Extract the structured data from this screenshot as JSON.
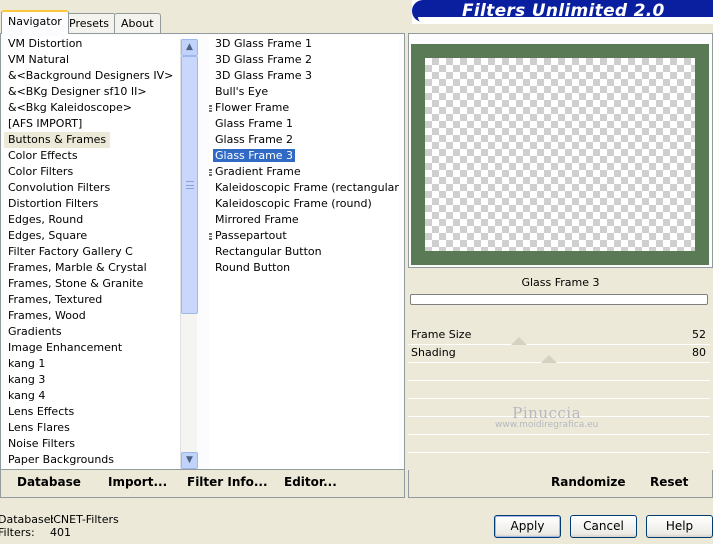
{
  "tabs": [
    {
      "label": "Navigator",
      "active": true
    },
    {
      "label": "Presets",
      "active": false
    },
    {
      "label": "About",
      "active": false
    }
  ],
  "banner_title": "Filters Unlimited 2.0",
  "categories": {
    "items": [
      "VM Distortion",
      "VM Natural",
      "&<Background Designers IV>",
      "&<BKg Designer sf10 II>",
      "&<Bkg Kaleidoscope>",
      "[AFS IMPORT]",
      "Buttons & Frames",
      "Color Effects",
      "Color Filters",
      "Convolution Filters",
      "Distortion Filters",
      "Edges, Round",
      "Edges, Square",
      "Filter Factory Gallery C",
      "Frames, Marble & Crystal",
      "Frames, Stone & Granite",
      "Frames, Textured",
      "Frames, Wood",
      "Gradients",
      "Image Enhancement",
      "kang 1",
      "kang 3",
      "kang 4",
      "Lens Effects",
      "Lens Flares",
      "Noise Filters",
      "Paper Backgrounds"
    ],
    "selected": "Buttons & Frames"
  },
  "filters": {
    "items": [
      "3D Glass Frame 1",
      "3D Glass Frame 2",
      "3D Glass Frame 3",
      "Bull's Eye",
      "Flower Frame",
      "Glass Frame 1",
      "Glass Frame 2",
      "Glass Frame 3",
      "Gradient Frame",
      "Kaleidoscopic Frame (rectangular)",
      "Kaleidoscopic Frame (round)",
      "Mirrored Frame",
      "Passepartout",
      "Rectangular Button",
      "Round Button"
    ],
    "selected": "Glass Frame 3",
    "marked": [
      "Flower Frame",
      "Gradient Frame",
      "Passepartout"
    ]
  },
  "toolbar_left": {
    "database": "Database",
    "import": "Import...",
    "filter_info": "Filter Info...",
    "editor": "Editor..."
  },
  "toolbar_right": {
    "randomize": "Randomize",
    "reset": "Reset"
  },
  "preview": {
    "filter_name": "Glass Frame 3"
  },
  "params": [
    {
      "label": "Frame Size",
      "value": "52",
      "level": 0.25
    },
    {
      "label": "Shading",
      "value": "80",
      "level": 0.4
    }
  ],
  "watermark": {
    "name": "Pinuccia",
    "site": "www.moidiregrafica.eu"
  },
  "status": {
    "database_label": "Database:",
    "database_value": "ICNET-Filters",
    "filters_label": "Filters:",
    "filters_value": "401"
  },
  "buttons": {
    "apply": "Apply",
    "cancel": "Cancel",
    "help": "Help"
  },
  "colors": {
    "selection": "#316ac5",
    "banner": "#0a1fa0",
    "frame": "#5a7a56"
  }
}
